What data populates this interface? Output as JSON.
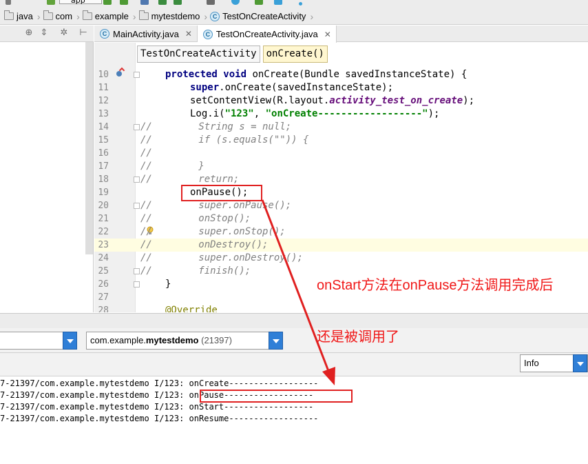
{
  "toolbar": {
    "partial_label": "app"
  },
  "breadcrumb": {
    "items": [
      {
        "label": "java",
        "icon": "folder-icon"
      },
      {
        "label": "com",
        "icon": "folder-icon"
      },
      {
        "label": "example",
        "icon": "folder-icon"
      },
      {
        "label": "mytestdemo",
        "icon": "folder-icon"
      },
      {
        "label": "TestOnCreateActivity",
        "icon": "class-icon"
      }
    ]
  },
  "editor_tabs": [
    {
      "label": "MainActivity.java",
      "active": false
    },
    {
      "label": "TestOnCreateActivity.java",
      "active": true
    }
  ],
  "class_icon_letter": "C",
  "code_breadcrumb": {
    "class_name": "TestOnCreateActivity",
    "method_name": "onCreate()"
  },
  "editor": {
    "lines": {
      "l10": "10",
      "l11": "11",
      "l12": "12",
      "l13": "13",
      "l14": "14",
      "l15": "15",
      "l16": "16",
      "l17": "17",
      "l18": "18",
      "l19": "19",
      "l20": "20",
      "l21": "21",
      "l22": "22",
      "l23": "23",
      "l24": "24",
      "l25": "25",
      "l26": "26",
      "l27": "27",
      "l28": "28"
    },
    "code": {
      "l10_kw": "protected void",
      "l10_rest": " onCreate(Bundle savedInstanceState) {",
      "l11_kw": "super",
      "l11_rest": ".onCreate(savedInstanceState);",
      "l12_a": "setContentView(R.layout.",
      "l12_field": "activity_test_on_create",
      "l12_b": ");",
      "l13_a": "Log.i(",
      "l13_s1": "\"123\"",
      "l13_sep": ", ",
      "l13_s2": "\"onCreate------------------\"",
      "l13_b": ");",
      "l14": "//        String s = null;",
      "l15": "//        if (s.equals(\"\")) {",
      "l16": "//",
      "l17": "//        }",
      "l18": "//        return;",
      "l19": "onPause();",
      "l20": "//        super.onPause();",
      "l21": "//        onStop();",
      "l22": "//        super.onStop();",
      "l23": "//        onDestroy();",
      "l24": "//        super.onDestroy();",
      "l25": "//        finish();",
      "l26": "}",
      "l28": "@Override"
    }
  },
  "annotation": {
    "line1": "onStart方法在onPause方法调用完成后",
    "line2": "还是被调用了"
  },
  "logcat": {
    "process_select": {
      "package_prefix": "com.example.",
      "package_bold": "mytestdemo",
      "pid": " (21397)"
    },
    "level_select": "Info",
    "lines": [
      {
        "prefix": "7-21397/com.example.mytestdemo I/123: ",
        "message": "onCreate------------------"
      },
      {
        "prefix": "7-21397/com.example.mytestdemo I/123: ",
        "message": "onPause------------------"
      },
      {
        "prefix": "7-21397/com.example.mytestdemo I/123: ",
        "message": "onStart------------------"
      },
      {
        "prefix": "7-21397/com.example.mytestdemo I/123: ",
        "message": "onResume------------------"
      }
    ]
  },
  "colors": {
    "annotation_red": "#e02020",
    "keyword": "#000080",
    "string": "#008000",
    "field": "#660e7a",
    "comment": "#808080",
    "dropdown_blue": "#2f7fd7"
  }
}
